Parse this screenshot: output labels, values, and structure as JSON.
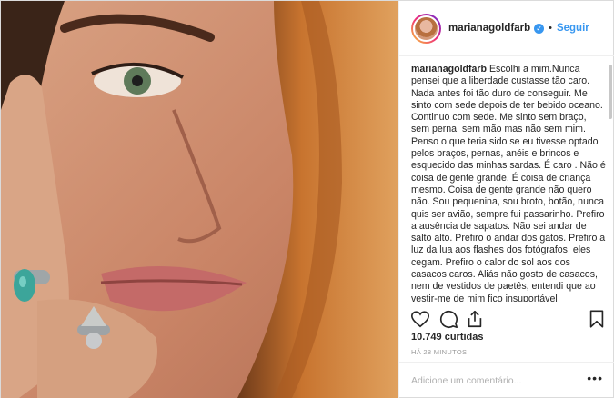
{
  "post": {
    "username": "marianagoldfarb",
    "follow_label": "Seguir",
    "separator": "•",
    "caption_user": "marianagoldfarb",
    "caption_text": "Escolhi a mim.Nunca pensei que a liberdade custasse tão caro. Nada antes foi tão duro de conseguir. Me sinto com sede depois de ter bebido oceano. Continuo com sede. Me sinto sem braço, sem perna, sem mão mas não sem mim. Penso o que teria sido se eu tivesse optado pelos braços, pernas, anéis e brincos e esquecido das minhas sardas. É caro . Não é coisa de gente grande. É coisa de criança mesmo. Coisa de gente grande não quero não. Sou pequenina, sou broto, botão, nunca quis ser avião, sempre fui passarinho. Prefiro a ausência de sapatos. Não sei andar de salto alto. Prefiro o andar dos gatos. Prefiro a luz da lua aos flashes dos fotógrafos, eles cegam. Prefiro o calor do sol aos dos casacos caros. Aliás não gosto de casacos, nem de vestidos de paetês, entendi que ao vestir-me de mim fico insuportável",
    "likes": "10.749 curtidas",
    "time": "HÁ 28 MINUTOS",
    "comment_placeholder": "Adicione um comentário...",
    "more_label": "•••"
  },
  "icons": {
    "verified": "verified-badge-icon",
    "like": "heart-icon",
    "comment": "comment-icon",
    "share": "share-icon",
    "save": "bookmark-icon"
  },
  "colors": {
    "accent": "#3897f0",
    "border": "#efefef",
    "hair": "#c8742f"
  }
}
